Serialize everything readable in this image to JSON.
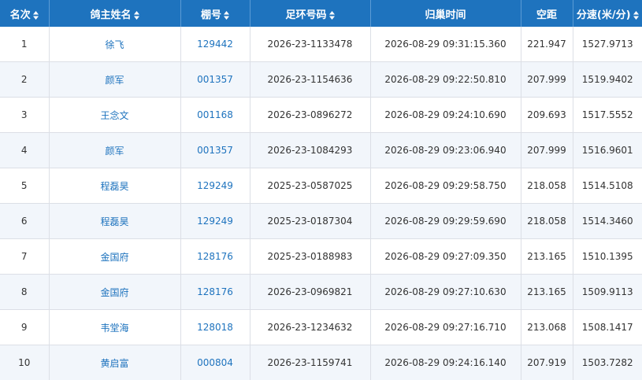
{
  "table": {
    "columns": [
      {
        "label": "名次",
        "sortable": true
      },
      {
        "label": "鸽主姓名",
        "sortable": true
      },
      {
        "label": "棚号",
        "sortable": true
      },
      {
        "label": "足环号码",
        "sortable": true
      },
      {
        "label": "归巢时间",
        "sortable": false
      },
      {
        "label": "空距",
        "sortable": false
      },
      {
        "label": "分速(米/分)",
        "sortable": true
      }
    ],
    "rows": [
      {
        "rank": "1",
        "owner": "徐飞",
        "loft": "129442",
        "ring": "2026-23-1133478",
        "arrival": "2026-08-29 09:31:15.360",
        "distance": "221.947",
        "speed": "1527.9713"
      },
      {
        "rank": "2",
        "owner": "颜军",
        "loft": "001357",
        "ring": "2026-23-1154636",
        "arrival": "2026-08-29 09:22:50.810",
        "distance": "207.999",
        "speed": "1519.9402"
      },
      {
        "rank": "3",
        "owner": "王念文",
        "loft": "001168",
        "ring": "2026-23-0896272",
        "arrival": "2026-08-29 09:24:10.690",
        "distance": "209.693",
        "speed": "1517.5552"
      },
      {
        "rank": "4",
        "owner": "颜军",
        "loft": "001357",
        "ring": "2026-23-1084293",
        "arrival": "2026-08-29 09:23:06.940",
        "distance": "207.999",
        "speed": "1516.9601"
      },
      {
        "rank": "5",
        "owner": "程磊昊",
        "loft": "129249",
        "ring": "2025-23-0587025",
        "arrival": "2026-08-29 09:29:58.750",
        "distance": "218.058",
        "speed": "1514.5108"
      },
      {
        "rank": "6",
        "owner": "程磊昊",
        "loft": "129249",
        "ring": "2025-23-0187304",
        "arrival": "2026-08-29 09:29:59.690",
        "distance": "218.058",
        "speed": "1514.3460"
      },
      {
        "rank": "7",
        "owner": "金国府",
        "loft": "128176",
        "ring": "2025-23-0188983",
        "arrival": "2026-08-29 09:27:09.350",
        "distance": "213.165",
        "speed": "1510.1395"
      },
      {
        "rank": "8",
        "owner": "金国府",
        "loft": "128176",
        "ring": "2026-23-0969821",
        "arrival": "2026-08-29 09:27:10.630",
        "distance": "213.165",
        "speed": "1509.9113"
      },
      {
        "rank": "9",
        "owner": "韦堂海",
        "loft": "128018",
        "ring": "2026-23-1234632",
        "arrival": "2026-08-29 09:27:16.710",
        "distance": "213.068",
        "speed": "1508.1417"
      },
      {
        "rank": "10",
        "owner": "黄启富",
        "loft": "000804",
        "ring": "2026-23-1159741",
        "arrival": "2026-08-29 09:24:16.140",
        "distance": "207.919",
        "speed": "1503.7282"
      }
    ]
  },
  "colors": {
    "header_bg": "#1e73be",
    "link": "#1e73be",
    "stripe": "#f2f6fb",
    "border": "#dcdfe6"
  },
  "icons": {
    "sort": "sort-icon"
  }
}
